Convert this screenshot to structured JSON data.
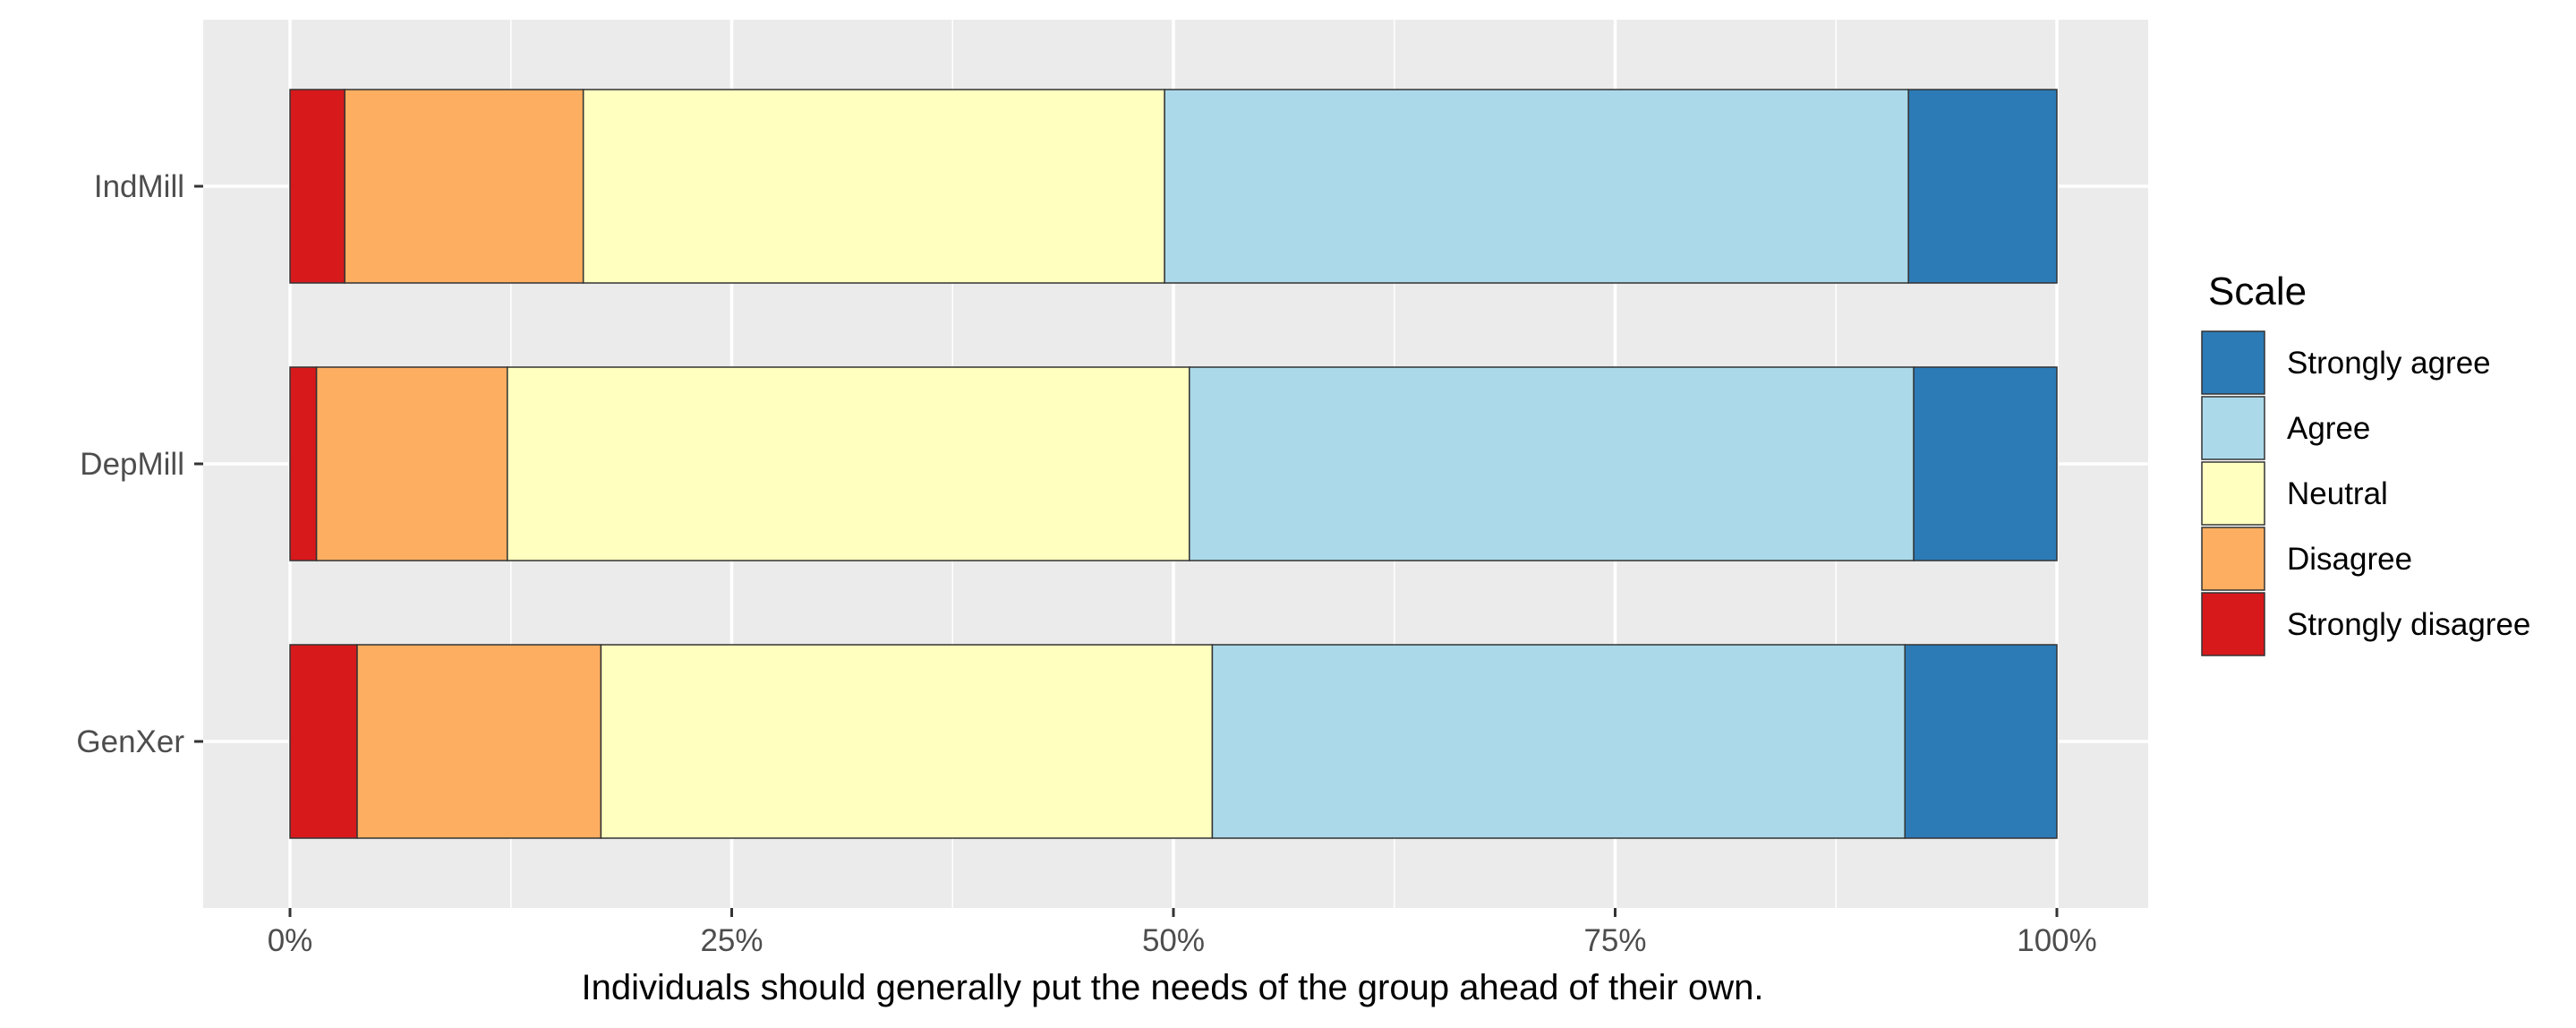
{
  "chart_data": {
    "type": "bar",
    "orientation": "horizontal",
    "stacked": "percent",
    "title": "",
    "xlabel": "Individuals should generally put the needs of the group ahead of their own.",
    "ylabel": "",
    "xlim": [
      0,
      100
    ],
    "x_ticks": [
      0,
      25,
      50,
      75,
      100
    ],
    "x_tick_labels": [
      "0%",
      "25%",
      "50%",
      "75%",
      "100%"
    ],
    "categories": [
      "IndMill",
      "DepMill",
      "GenXer"
    ],
    "series": [
      {
        "name": "Strongly disagree",
        "color": "#D7191C",
        "values": [
          3.1,
          1.5,
          3.8
        ]
      },
      {
        "name": "Disagree",
        "color": "#FDAE61",
        "values": [
          13.5,
          10.8,
          13.8
        ]
      },
      {
        "name": "Neutral",
        "color": "#FFFFBF",
        "values": [
          32.9,
          38.6,
          34.6
        ]
      },
      {
        "name": "Agree",
        "color": "#ABD9E9",
        "values": [
          42.1,
          41.0,
          39.2
        ]
      },
      {
        "name": "Strongly agree",
        "color": "#2C7BB6",
        "values": [
          8.4,
          8.1,
          8.6
        ]
      }
    ],
    "legend": {
      "title": "Scale",
      "position": "right",
      "order": [
        "Strongly agree",
        "Agree",
        "Neutral",
        "Disagree",
        "Strongly disagree"
      ]
    },
    "grid": true,
    "panel_background": "#EBEBEB",
    "grid_color": "#FFFFFF"
  }
}
